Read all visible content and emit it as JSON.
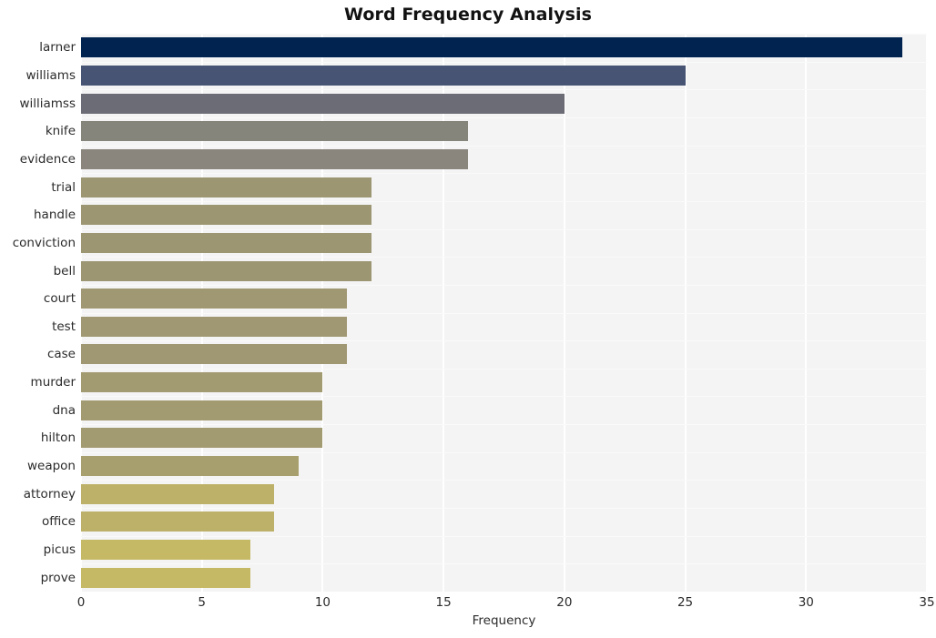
{
  "chart_data": {
    "type": "bar",
    "orientation": "horizontal",
    "title": "Word Frequency Analysis",
    "xlabel": "Frequency",
    "ylabel": "",
    "xlim": [
      0,
      35
    ],
    "xticks": [
      0,
      5,
      10,
      15,
      20,
      25,
      30,
      35
    ],
    "grid": true,
    "legend": null,
    "categories": [
      "larner",
      "williams",
      "williamss",
      "knife",
      "evidence",
      "trial",
      "handle",
      "conviction",
      "bell",
      "court",
      "test",
      "case",
      "murder",
      "dna",
      "hilton",
      "weapon",
      "attorney",
      "office",
      "picus",
      "prove"
    ],
    "values": [
      34,
      25,
      20,
      16,
      16,
      12,
      12,
      12,
      12,
      11,
      11,
      11,
      10,
      10,
      10,
      9,
      8,
      8,
      7,
      7
    ],
    "bar_colors": [
      "#00234f",
      "#485473",
      "#6b6c76",
      "#85857b",
      "#8a867e",
      "#9d9673",
      "#9d9673",
      "#9d9673",
      "#9d9673",
      "#a09872",
      "#a09872",
      "#a09872",
      "#a29a71",
      "#a29a71",
      "#a29a71",
      "#a89f6e",
      "#bdb169",
      "#bdb169",
      "#c6b965",
      "#c6b965"
    ],
    "plot_background": "#f4f4f5",
    "gridline_color": "#ffffff",
    "title_color": "#121212",
    "tick_color": "#2b2b2b"
  }
}
